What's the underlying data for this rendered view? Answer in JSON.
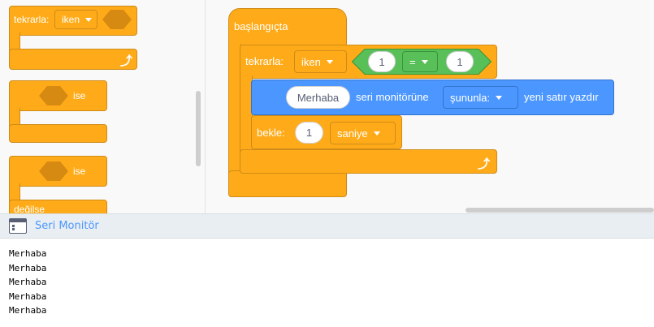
{
  "palette": {
    "repeat_block": {
      "label": "tekrarla:",
      "dropdown": "iken"
    },
    "if_block": {
      "label": "ise"
    },
    "if_else_block": {
      "if_label": "ise",
      "else_label": "değilse"
    }
  },
  "workspace": {
    "hat_block": {
      "label": "başlangıçta"
    },
    "repeat_block": {
      "label": "tekrarla:",
      "dropdown": "iken",
      "condition": {
        "left": "1",
        "operator": "=",
        "right": "1"
      }
    },
    "print_block": {
      "value": "Merhaba",
      "label": "seri monitörüne",
      "dropdown": "şununla:",
      "suffix": "yeni satır yazdır"
    },
    "wait_block": {
      "label": "bekle:",
      "value": "1",
      "dropdown": "saniye"
    }
  },
  "monitor": {
    "title": "Seri Monitör",
    "lines": [
      "Merhaba",
      "Merhaba",
      "Merhaba",
      "Merhaba",
      "Merhaba"
    ]
  },
  "colors": {
    "control": "#ffab19",
    "output": "#4c97ff",
    "operator": "#59c059",
    "monitor_title": "#4c97ff"
  },
  "icons": [
    "loop-arrow-icon",
    "dropdown-arrow-icon",
    "serial-monitor-icon"
  ]
}
